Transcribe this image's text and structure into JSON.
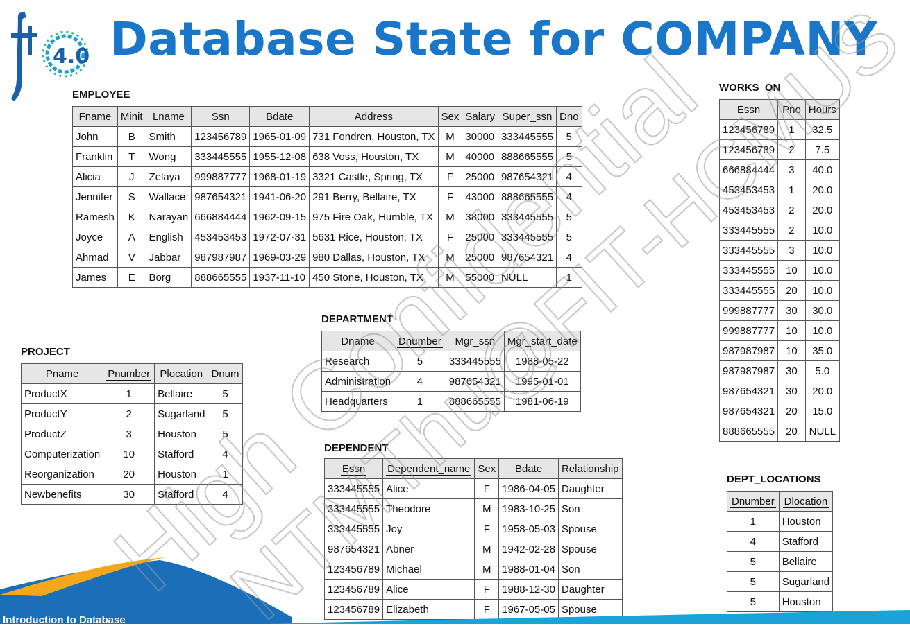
{
  "title": "Database State for COMPANY",
  "logo": {
    "text": "4.0",
    "letters": "fit"
  },
  "footer": {
    "text": "Introduction to Database"
  },
  "watermark": {
    "line1": "High Confidential",
    "line2": "NTMThu@FIT-HCMUS"
  },
  "employee": {
    "name": "EMPLOYEE",
    "headers": [
      "Fname",
      "Minit",
      "Lname",
      "Ssn",
      "Bdate",
      "Address",
      "Sex",
      "Salary",
      "Super_ssn",
      "Dno"
    ],
    "rows": [
      [
        "John",
        "B",
        "Smith",
        "123456789",
        "1965-01-09",
        "731 Fondren, Houston, TX",
        "M",
        "30000",
        "333445555",
        "5"
      ],
      [
        "Franklin",
        "T",
        "Wong",
        "333445555",
        "1955-12-08",
        "638 Voss, Houston, TX",
        "M",
        "40000",
        "888665555",
        "5"
      ],
      [
        "Alicia",
        "J",
        "Zelaya",
        "999887777",
        "1968-01-19",
        "3321 Castle, Spring, TX",
        "F",
        "25000",
        "987654321",
        "4"
      ],
      [
        "Jennifer",
        "S",
        "Wallace",
        "987654321",
        "1941-06-20",
        "291 Berry, Bellaire, TX",
        "F",
        "43000",
        "888665555",
        "4"
      ],
      [
        "Ramesh",
        "K",
        "Narayan",
        "666884444",
        "1962-09-15",
        "975 Fire Oak, Humble, TX",
        "M",
        "38000",
        "333445555",
        "5"
      ],
      [
        "Joyce",
        "A",
        "English",
        "453453453",
        "1972-07-31",
        "5631 Rice, Houston, TX",
        "F",
        "25000",
        "333445555",
        "5"
      ],
      [
        "Ahmad",
        "V",
        "Jabbar",
        "987987987",
        "1969-03-29",
        "980 Dallas, Houston, TX",
        "M",
        "25000",
        "987654321",
        "4"
      ],
      [
        "James",
        "E",
        "Borg",
        "888665555",
        "1937-11-10",
        "450 Stone, Houston, TX",
        "M",
        "55000",
        "NULL",
        "1"
      ]
    ]
  },
  "works_on": {
    "name": "WORKS_ON",
    "headers": [
      "Essn",
      "Pno",
      "Hours"
    ],
    "rows": [
      [
        "123456789",
        "1",
        "32.5"
      ],
      [
        "123456789",
        "2",
        "7.5"
      ],
      [
        "666884444",
        "3",
        "40.0"
      ],
      [
        "453453453",
        "1",
        "20.0"
      ],
      [
        "453453453",
        "2",
        "20.0"
      ],
      [
        "333445555",
        "2",
        "10.0"
      ],
      [
        "333445555",
        "3",
        "10.0"
      ],
      [
        "333445555",
        "10",
        "10.0"
      ],
      [
        "333445555",
        "20",
        "10.0"
      ],
      [
        "999887777",
        "30",
        "30.0"
      ],
      [
        "999887777",
        "10",
        "10.0"
      ],
      [
        "987987987",
        "10",
        "35.0"
      ],
      [
        "987987987",
        "30",
        "5.0"
      ],
      [
        "987654321",
        "30",
        "20.0"
      ],
      [
        "987654321",
        "20",
        "15.0"
      ],
      [
        "888665555",
        "20",
        "NULL"
      ]
    ]
  },
  "department": {
    "name": "DEPARTMENT",
    "headers": [
      "Dname",
      "Dnumber",
      "Mgr_ssn",
      "Mgr_start_date"
    ],
    "rows": [
      [
        "Research",
        "5",
        "333445555",
        "1988-05-22"
      ],
      [
        "Administration",
        "4",
        "987654321",
        "1995-01-01"
      ],
      [
        "Headquarters",
        "1",
        "888665555",
        "1981-06-19"
      ]
    ]
  },
  "project": {
    "name": "PROJECT",
    "headers": [
      "Pname",
      "Pnumber",
      "Plocation",
      "Dnum"
    ],
    "rows": [
      [
        "ProductX",
        "1",
        "Bellaire",
        "5"
      ],
      [
        "ProductY",
        "2",
        "Sugarland",
        "5"
      ],
      [
        "ProductZ",
        "3",
        "Houston",
        "5"
      ],
      [
        "Computerization",
        "10",
        "Stafford",
        "4"
      ],
      [
        "Reorganization",
        "20",
        "Houston",
        "1"
      ],
      [
        "Newbenefits",
        "30",
        "Stafford",
        "4"
      ]
    ]
  },
  "dependent": {
    "name": "DEPENDENT",
    "headers": [
      "Essn",
      "Dependent_name",
      "Sex",
      "Bdate",
      "Relationship"
    ],
    "rows": [
      [
        "333445555",
        "Alice",
        "F",
        "1986-04-05",
        "Daughter"
      ],
      [
        "333445555",
        "Theodore",
        "M",
        "1983-10-25",
        "Son"
      ],
      [
        "333445555",
        "Joy",
        "F",
        "1958-05-03",
        "Spouse"
      ],
      [
        "987654321",
        "Abner",
        "M",
        "1942-02-28",
        "Spouse"
      ],
      [
        "123456789",
        "Michael",
        "M",
        "1988-01-04",
        "Son"
      ],
      [
        "123456789",
        "Alice",
        "F",
        "1988-12-30",
        "Daughter"
      ],
      [
        "123456789",
        "Elizabeth",
        "F",
        "1967-05-05",
        "Spouse"
      ]
    ]
  },
  "dept_locations": {
    "name": "DEPT_LOCATIONS",
    "headers": [
      "Dnumber",
      "Dlocation"
    ],
    "rows": [
      [
        "1",
        "Houston"
      ],
      [
        "4",
        "Stafford"
      ],
      [
        "5",
        "Bellaire"
      ],
      [
        "5",
        "Sugarland"
      ],
      [
        "5",
        "Houston"
      ]
    ]
  }
}
